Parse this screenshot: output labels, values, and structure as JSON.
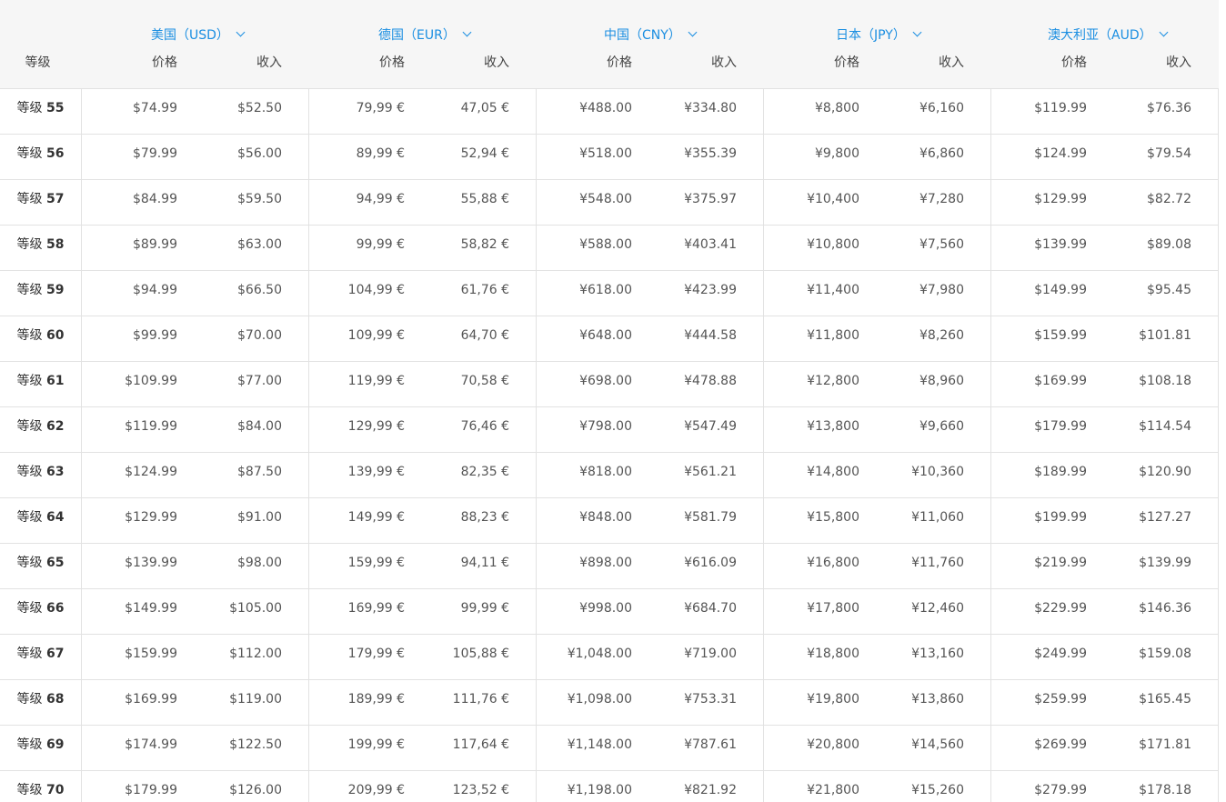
{
  "header": {
    "tier_label": "等级",
    "price_label": "价格",
    "revenue_label": "收入",
    "countries": [
      {
        "name": "美国（USD）"
      },
      {
        "name": "德国（EUR）"
      },
      {
        "name": "中国（CNY）"
      },
      {
        "name": "日本（JPY）"
      },
      {
        "name": "澳大利亚（AUD）"
      }
    ]
  },
  "tier_prefix": "等级",
  "rows": [
    {
      "tier": "55",
      "values": [
        "$74.99",
        "$52.50",
        "79,99 €",
        "47,05 €",
        "¥488.00",
        "¥334.80",
        "¥8,800",
        "¥6,160",
        "$119.99",
        "$76.36"
      ]
    },
    {
      "tier": "56",
      "values": [
        "$79.99",
        "$56.00",
        "89,99 €",
        "52,94 €",
        "¥518.00",
        "¥355.39",
        "¥9,800",
        "¥6,860",
        "$124.99",
        "$79.54"
      ]
    },
    {
      "tier": "57",
      "values": [
        "$84.99",
        "$59.50",
        "94,99 €",
        "55,88 €",
        "¥548.00",
        "¥375.97",
        "¥10,400",
        "¥7,280",
        "$129.99",
        "$82.72"
      ]
    },
    {
      "tier": "58",
      "values": [
        "$89.99",
        "$63.00",
        "99,99 €",
        "58,82 €",
        "¥588.00",
        "¥403.41",
        "¥10,800",
        "¥7,560",
        "$139.99",
        "$89.08"
      ]
    },
    {
      "tier": "59",
      "values": [
        "$94.99",
        "$66.50",
        "104,99 €",
        "61,76 €",
        "¥618.00",
        "¥423.99",
        "¥11,400",
        "¥7,980",
        "$149.99",
        "$95.45"
      ]
    },
    {
      "tier": "60",
      "values": [
        "$99.99",
        "$70.00",
        "109,99 €",
        "64,70 €",
        "¥648.00",
        "¥444.58",
        "¥11,800",
        "¥8,260",
        "$159.99",
        "$101.81"
      ]
    },
    {
      "tier": "61",
      "values": [
        "$109.99",
        "$77.00",
        "119,99 €",
        "70,58 €",
        "¥698.00",
        "¥478.88",
        "¥12,800",
        "¥8,960",
        "$169.99",
        "$108.18"
      ]
    },
    {
      "tier": "62",
      "values": [
        "$119.99",
        "$84.00",
        "129,99 €",
        "76,46 €",
        "¥798.00",
        "¥547.49",
        "¥13,800",
        "¥9,660",
        "$179.99",
        "$114.54"
      ]
    },
    {
      "tier": "63",
      "values": [
        "$124.99",
        "$87.50",
        "139,99 €",
        "82,35 €",
        "¥818.00",
        "¥561.21",
        "¥14,800",
        "¥10,360",
        "$189.99",
        "$120.90"
      ]
    },
    {
      "tier": "64",
      "values": [
        "$129.99",
        "$91.00",
        "149,99 €",
        "88,23 €",
        "¥848.00",
        "¥581.79",
        "¥15,800",
        "¥11,060",
        "$199.99",
        "$127.27"
      ]
    },
    {
      "tier": "65",
      "values": [
        "$139.99",
        "$98.00",
        "159,99 €",
        "94,11 €",
        "¥898.00",
        "¥616.09",
        "¥16,800",
        "¥11,760",
        "$219.99",
        "$139.99"
      ]
    },
    {
      "tier": "66",
      "values": [
        "$149.99",
        "$105.00",
        "169,99 €",
        "99,99 €",
        "¥998.00",
        "¥684.70",
        "¥17,800",
        "¥12,460",
        "$229.99",
        "$146.36"
      ]
    },
    {
      "tier": "67",
      "values": [
        "$159.99",
        "$112.00",
        "179,99 €",
        "105,88 €",
        "¥1,048.00",
        "¥719.00",
        "¥18,800",
        "¥13,160",
        "$249.99",
        "$159.08"
      ]
    },
    {
      "tier": "68",
      "values": [
        "$169.99",
        "$119.00",
        "189,99 €",
        "111,76 €",
        "¥1,098.00",
        "¥753.31",
        "¥19,800",
        "¥13,860",
        "$259.99",
        "$165.45"
      ]
    },
    {
      "tier": "69",
      "values": [
        "$174.99",
        "$122.50",
        "199,99 €",
        "117,64 €",
        "¥1,148.00",
        "¥787.61",
        "¥20,800",
        "¥14,560",
        "$269.99",
        "$171.81"
      ]
    },
    {
      "tier": "70",
      "values": [
        "$179.99",
        "$126.00",
        "209,99 €",
        "123,52 €",
        "¥1,198.00",
        "¥821.92",
        "¥21,800",
        "¥15,260",
        "$279.99",
        "$178.18"
      ]
    }
  ]
}
